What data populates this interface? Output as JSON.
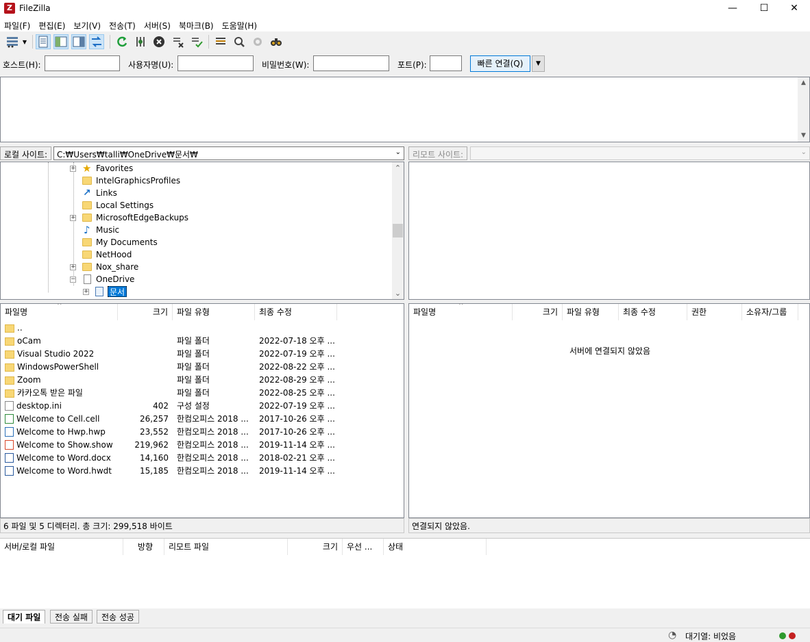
{
  "window": {
    "title": "FileZilla",
    "minimize_icon": "minimize-icon",
    "maximize_icon": "maximize-icon",
    "close_icon": "close-icon"
  },
  "menu": [
    "파일(F)",
    "편집(E)",
    "보기(V)",
    "전송(T)",
    "서버(S)",
    "북마크(B)",
    "도움말(H)"
  ],
  "quickconnect": {
    "host_label": "호스트(H):",
    "host_value": "",
    "user_label": "사용자명(U):",
    "user_value": "",
    "pass_label": "비밀번호(W):",
    "pass_value": "",
    "port_label": "포트(P):",
    "port_value": "",
    "connect_label": "빠른 연결(Q)"
  },
  "local": {
    "site_label": "로컬 사이트:",
    "path": "C:₩Users₩talli₩OneDrive₩문서₩",
    "tree": [
      {
        "label": "Favorites",
        "icon": "star",
        "expander": "+"
      },
      {
        "label": "IntelGraphicsProfiles",
        "icon": "folder",
        "expander": ""
      },
      {
        "label": "Links",
        "icon": "link",
        "expander": ""
      },
      {
        "label": "Local Settings",
        "icon": "folder",
        "expander": ""
      },
      {
        "label": "MicrosoftEdgeBackups",
        "icon": "folder",
        "expander": "+"
      },
      {
        "label": "Music",
        "icon": "music",
        "expander": ""
      },
      {
        "label": "My Documents",
        "icon": "folder",
        "expander": ""
      },
      {
        "label": "NetHood",
        "icon": "folder",
        "expander": ""
      },
      {
        "label": "Nox_share",
        "icon": "folder",
        "expander": "+"
      },
      {
        "label": "OneDrive",
        "icon": "doc",
        "expander": "-"
      },
      {
        "label": "문서",
        "icon": "doc-selected",
        "expander": "+"
      }
    ],
    "columns": [
      "파일명",
      "크기",
      "파일 유형",
      "최종 수정"
    ],
    "files": [
      {
        "name": "..",
        "size": "",
        "type": "",
        "modified": "",
        "icon": "folder"
      },
      {
        "name": "oCam",
        "size": "",
        "type": "파일 폴더",
        "modified": "2022-07-18 오후 ...",
        "icon": "folder"
      },
      {
        "name": "Visual Studio 2022",
        "size": "",
        "type": "파일 폴더",
        "modified": "2022-07-19 오후 ...",
        "icon": "folder"
      },
      {
        "name": "WindowsPowerShell",
        "size": "",
        "type": "파일 폴더",
        "modified": "2022-08-22 오후 ...",
        "icon": "folder"
      },
      {
        "name": "Zoom",
        "size": "",
        "type": "파일 폴더",
        "modified": "2022-08-29 오후 ...",
        "icon": "folder"
      },
      {
        "name": "카카오톡 받은 파일",
        "size": "",
        "type": "파일 폴더",
        "modified": "2022-08-25 오후 ...",
        "icon": "folder"
      },
      {
        "name": "desktop.ini",
        "size": "402",
        "type": "구성 설정",
        "modified": "2022-07-19 오후 ...",
        "icon": "ini"
      },
      {
        "name": "Welcome to Cell.cell",
        "size": "26,257",
        "type": "한컴오피스 2018 ...",
        "modified": "2017-10-26 오후 ...",
        "icon": "cell"
      },
      {
        "name": "Welcome to Hwp.hwp",
        "size": "23,552",
        "type": "한컴오피스 2018 ...",
        "modified": "2017-10-26 오후 ...",
        "icon": "hwp"
      },
      {
        "name": "Welcome to Show.show",
        "size": "219,962",
        "type": "한컴오피스 2018 ...",
        "modified": "2019-11-14 오후 ...",
        "icon": "show"
      },
      {
        "name": "Welcome to Word.docx",
        "size": "14,160",
        "type": "한컴오피스 2018 ...",
        "modified": "2018-02-21 오후 ...",
        "icon": "word"
      },
      {
        "name": "Welcome to Word.hwdt",
        "size": "15,185",
        "type": "한컴오피스 2018 ...",
        "modified": "2019-11-14 오후 ...",
        "icon": "word"
      }
    ],
    "status": "6 파일 및 5 디렉터리. 총 크기: 299,518 바이트"
  },
  "remote": {
    "site_label": "리모트 사이트:",
    "path": "",
    "columns": [
      "파일명",
      "크기",
      "파일 유형",
      "최종 수정",
      "권한",
      "소유자/그룹"
    ],
    "empty_message": "서버에 연결되지 않았음",
    "status": "연결되지 않았음."
  },
  "queue": {
    "columns": [
      "서버/로컬 파일",
      "방향",
      "리모트 파일",
      "크기",
      "우선 ...",
      "상태"
    ],
    "tabs": [
      "대기 파일",
      "전송 실패",
      "전송 성공"
    ]
  },
  "statusbar": {
    "queue_text": "대기열: 비었음",
    "led_colors": [
      "#2e9a2e",
      "#c42020"
    ]
  }
}
